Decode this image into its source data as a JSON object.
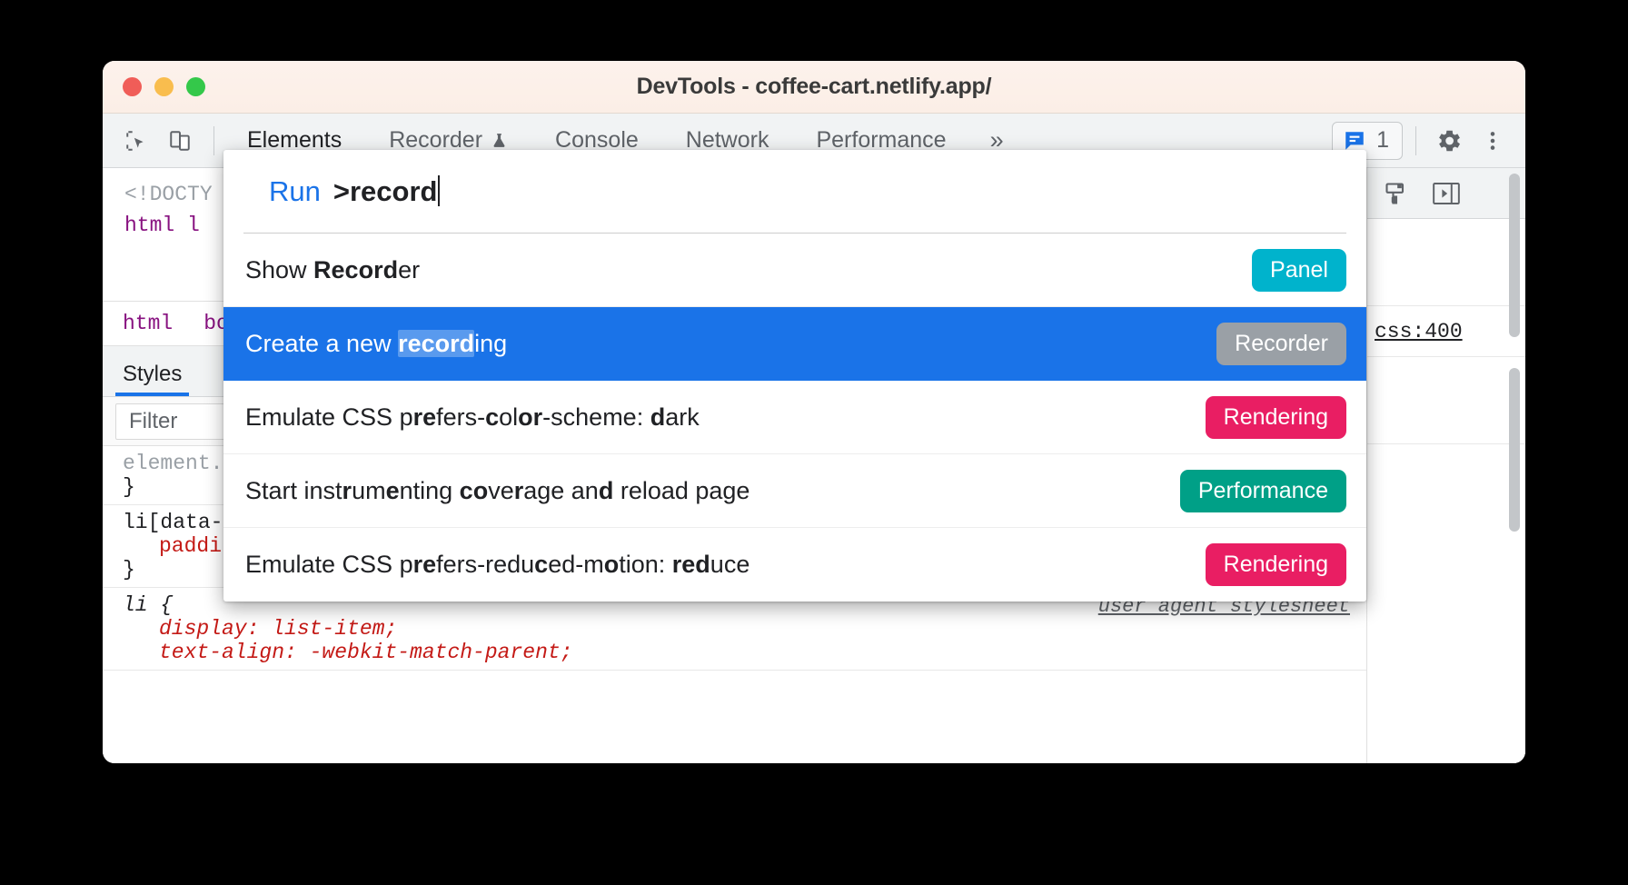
{
  "window": {
    "title": "DevTools - coffee-cart.netlify.app/",
    "traffic_lights": [
      "close",
      "minimize",
      "zoom"
    ]
  },
  "toolbar": {
    "inspect_icon": "inspect-element-icon",
    "device_icon": "device-toolbar-icon",
    "tabs": [
      {
        "label": "Elements",
        "active": true,
        "icon": null
      },
      {
        "label": "Recorder",
        "active": false,
        "icon": "experiment-flask-icon"
      },
      {
        "label": "Console",
        "active": false,
        "icon": null
      },
      {
        "label": "Network",
        "active": false,
        "icon": null
      },
      {
        "label": "Performance",
        "active": false,
        "icon": null
      }
    ],
    "more_tabs_label": "»",
    "issues": {
      "icon": "message-icon",
      "count": "1"
    },
    "settings_icon": "gear-icon",
    "menu_icon": "kebab-menu-icon"
  },
  "elements_panel": {
    "dom": [
      "<!DOCTY",
      "html l"
    ],
    "breadcrumb": [
      "html",
      "bod"
    ]
  },
  "styles_panel": {
    "tab_label": "Styles",
    "filter_placeholder": "Filter",
    "rules": [
      {
        "selector": "element.s",
        "close": "}",
        "origin": ""
      },
      {
        "selector": "li[data-v",
        "declaration": "paddin",
        "close": "}",
        "origin": ""
      },
      {
        "selector": "li {",
        "declaration_1": "display: list-item;",
        "declaration_2": "text-align: -webkit-match-parent;",
        "origin": "user agent stylesheet"
      }
    ]
  },
  "computed_pane": {
    "toolbar_icons": [
      "color-picker-icon",
      "toggle-sidebar-icon"
    ],
    "origin_link": "css:400"
  },
  "command_palette": {
    "prefix": "Run",
    "query": ">record",
    "results": [
      {
        "parts": [
          {
            "text": "Show ",
            "bold": false
          },
          {
            "text": "Record",
            "bold": true
          },
          {
            "text": "er",
            "bold": false
          }
        ],
        "plain": "Show Recorder",
        "badge": "Panel",
        "badge_kind": "panel",
        "selected": false
      },
      {
        "parts": [
          {
            "text": "Create a new ",
            "bold": false
          },
          {
            "text": "record",
            "bold": true
          },
          {
            "text": "ing",
            "bold": false
          }
        ],
        "plain": "Create a new recording",
        "badge": "Recorder",
        "badge_kind": "recorder",
        "selected": true
      },
      {
        "parts": [
          {
            "text": "Emulate CSS p",
            "bold": false
          },
          {
            "text": "re",
            "bold": true
          },
          {
            "text": "fers-",
            "bold": false
          },
          {
            "text": "c",
            "bold": true
          },
          {
            "text": "ol",
            "bold": false
          },
          {
            "text": "or",
            "bold": true
          },
          {
            "text": "-scheme: ",
            "bold": false
          },
          {
            "text": "d",
            "bold": true
          },
          {
            "text": "ark",
            "bold": false
          }
        ],
        "plain": "Emulate CSS prefers-color-scheme: dark",
        "badge": "Rendering",
        "badge_kind": "rendering",
        "selected": false
      },
      {
        "parts": [
          {
            "text": "Start inst",
            "bold": false
          },
          {
            "text": "r",
            "bold": true
          },
          {
            "text": "um",
            "bold": false
          },
          {
            "text": "e",
            "bold": true
          },
          {
            "text": "nting ",
            "bold": false
          },
          {
            "text": "co",
            "bold": true
          },
          {
            "text": "ve",
            "bold": false
          },
          {
            "text": "r",
            "bold": true
          },
          {
            "text": "age an",
            "bold": false
          },
          {
            "text": "d",
            "bold": true
          },
          {
            "text": " reload page",
            "bold": false
          }
        ],
        "plain": "Start instrumenting coverage and reload page",
        "badge": "Performance",
        "badge_kind": "performance",
        "selected": false
      },
      {
        "parts": [
          {
            "text": "Emulate CSS p",
            "bold": false
          },
          {
            "text": "re",
            "bold": true
          },
          {
            "text": "fers-redu",
            "bold": false
          },
          {
            "text": "c",
            "bold": true
          },
          {
            "text": "ed-m",
            "bold": false
          },
          {
            "text": "o",
            "bold": true
          },
          {
            "text": "tion: ",
            "bold": false
          },
          {
            "text": "red",
            "bold": true
          },
          {
            "text": "uce",
            "bold": false
          }
        ],
        "plain": "Emulate CSS prefers-reduced-motion: reduce",
        "badge": "Rendering",
        "badge_kind": "rendering",
        "selected": false
      }
    ]
  },
  "colors": {
    "selection_blue": "#1a73e8",
    "badge_panel": "#00b3cc",
    "badge_recorder": "#9aa0a6",
    "badge_rendering": "#e91e63",
    "badge_performance": "#00a087",
    "titlebar": "#fbeee6",
    "toolbar": "#f1f3f4"
  }
}
